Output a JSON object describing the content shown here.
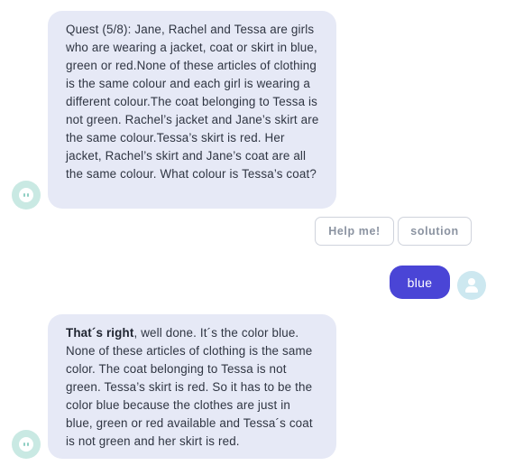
{
  "messages": [
    {
      "sender": "bot",
      "text": "Quest (5/8): Jane, Rachel and Tessa are girls who are wearing a jacket, coat or skirt in blue, green or red.None of these articles of clothing is the same colour and each girl is wearing a different colour.The coat belonging to Tessa is not green. Rachel’s jacket and Jane’s skirt are the same colour.Tessa’s skirt is red. Her jacket, Rachel’s skirt and Jane’s coat are all the same colour. What colour is Tessa’s coat?"
    },
    {
      "sender": "user",
      "text": "blue"
    },
    {
      "sender": "bot",
      "bold": "That´s right",
      "text": ", well done. It´s the color blue. None of these articles of clothing is the same color. The coat belonging to Tessa is not green. Tessa’s skirt is red. So it has to be the color blue because the clothes are just in blue, green or red available and Tessa´s coat is not green and her skirt is red."
    }
  ],
  "quick_replies": {
    "help": "Help me!",
    "solution": "solution"
  },
  "icons": {
    "bot_avatar": "bot-face-icon",
    "user_avatar": "user-person-icon"
  },
  "colors": {
    "bot_bubble": "#e6e9f6",
    "user_bubble": "#4a45d6",
    "bot_avatar": "#c9e9e3",
    "user_avatar": "#cde8f0"
  }
}
